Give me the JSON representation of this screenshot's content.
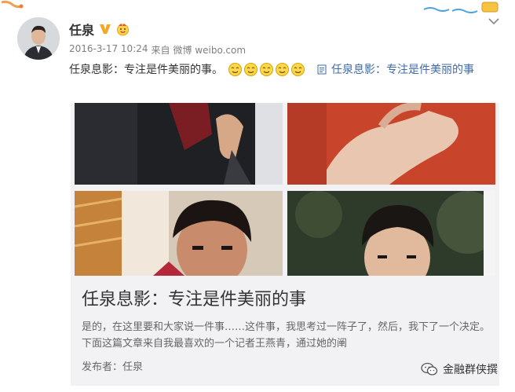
{
  "user": {
    "name": "任泉"
  },
  "meta": {
    "time": "2016-3-17 10:24",
    "from_label": "来自",
    "source": "微博 weibo.com"
  },
  "post": {
    "text": "任泉息影：专注是件美丽的事。",
    "link_text": "任泉息影：专注是件美丽的事"
  },
  "card": {
    "title": "任泉息影：专注是件美丽的事",
    "description": "是的，在这里要和大家说一件事……这件事，我思考过一阵子了，然后，我下了一个决定。下面这篇文章来自我最喜欢的一个记者王燕青，通过她的阐",
    "publisher_label": "发布者：",
    "publisher": "任泉"
  },
  "watermark": {
    "text": "金融群侠撰"
  },
  "icons": {
    "verified": "verified-v-icon",
    "emoji_badge": "emoji-badge-icon",
    "chevron": "chevron-down-icon",
    "face": "smiley-face-icon",
    "document": "document-icon",
    "watermark": "wechat-icon"
  },
  "colors": {
    "link": "#3f6ba9",
    "verified": "#f5a623",
    "card_bg": "#f2f2f5"
  }
}
